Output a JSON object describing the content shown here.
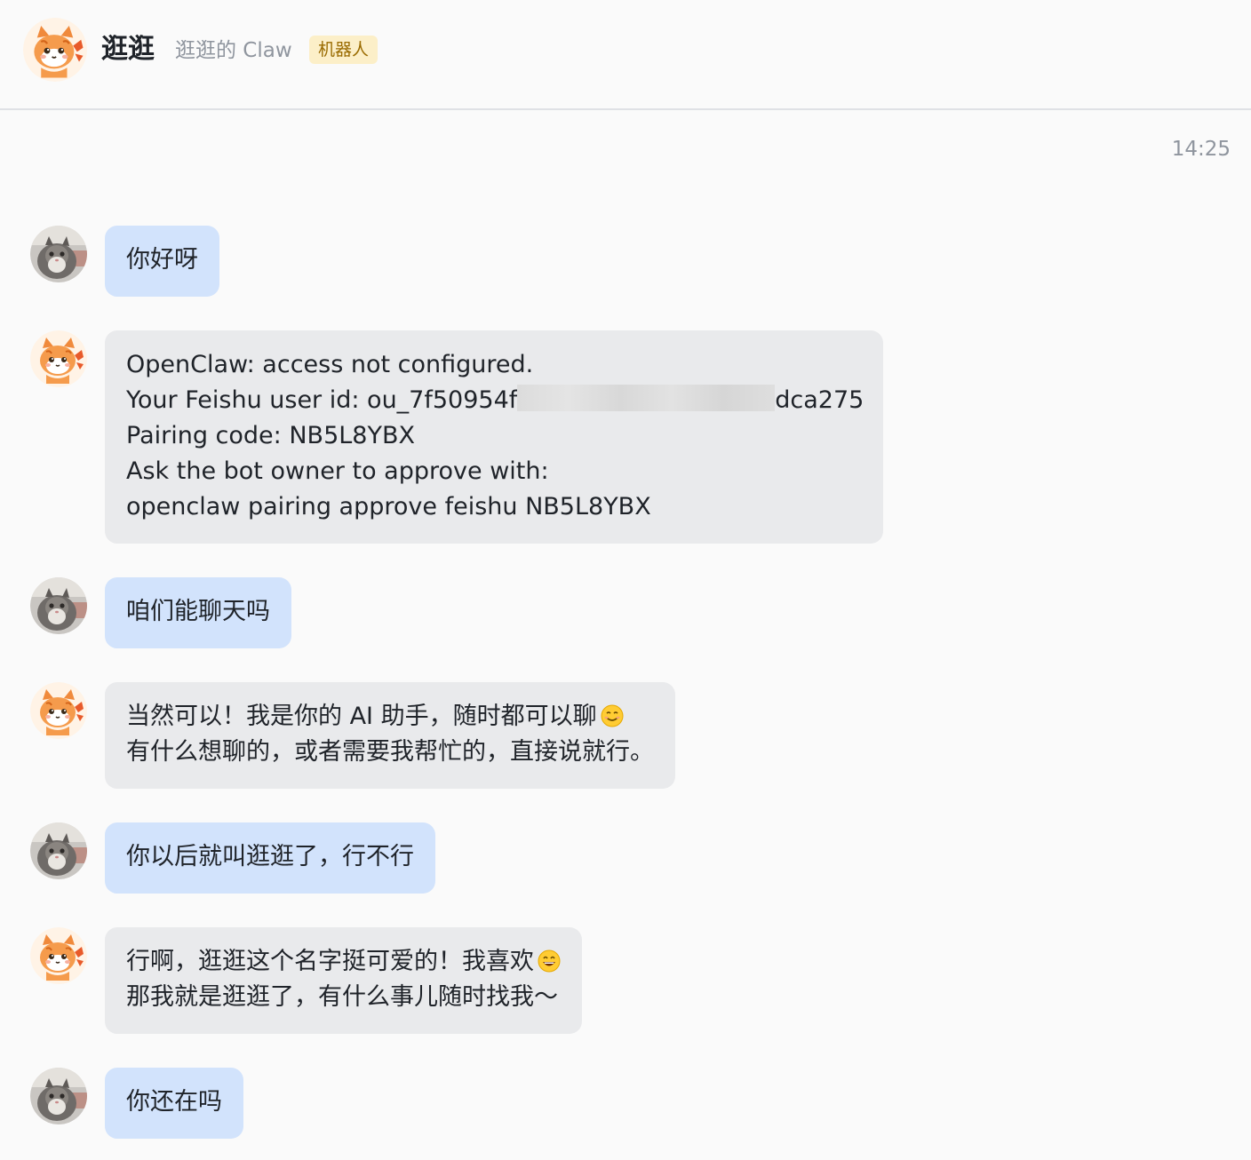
{
  "header": {
    "title": "逛逛",
    "subtitle": "逛逛的 Claw",
    "badge": "机器人"
  },
  "timestamp": "14:25",
  "messages": [
    {
      "sender": "user",
      "lines": [
        "你好呀"
      ]
    },
    {
      "sender": "bot",
      "lines": [
        "OpenClaw: access not configured.",
        "Your Feishu user id: ou_7f50954f",
        "Pairing code: NB5L8YBX",
        "Ask the bot owner to approve with:",
        "openclaw pairing approve feishu NB5L8YBX"
      ],
      "id_suffix": "dca275"
    },
    {
      "sender": "user",
      "lines": [
        "咱们能聊天吗"
      ]
    },
    {
      "sender": "bot",
      "lines": [
        "当然可以！我是你的 AI 助手，随时都可以聊",
        "有什么想聊的，或者需要我帮忙的，直接说就行。"
      ],
      "emoji": "smiling-face-icon"
    },
    {
      "sender": "user",
      "lines": [
        "你以后就叫逛逛了，行不行"
      ]
    },
    {
      "sender": "bot",
      "lines": [
        "行啊，逛逛这个名字挺可爱的！我喜欢",
        "那我就是逛逛了，有什么事儿随时找我～"
      ],
      "emoji": "grinning-face-icon"
    },
    {
      "sender": "user",
      "lines": [
        "你还在吗"
      ]
    }
  ]
}
